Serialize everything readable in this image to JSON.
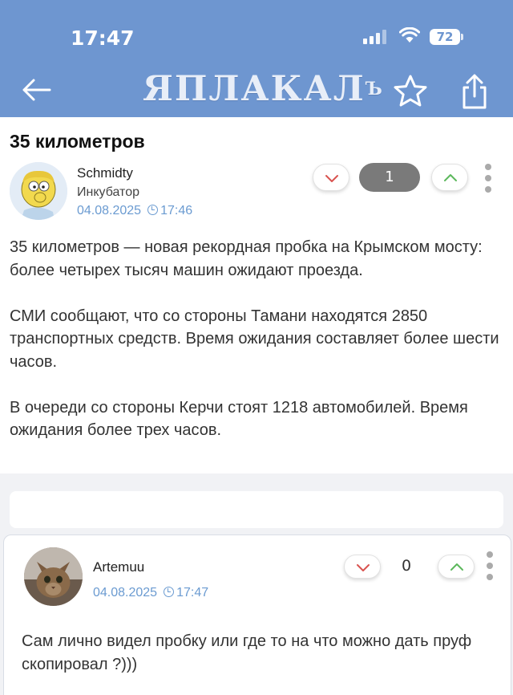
{
  "status_bar": {
    "time": "17:47",
    "battery": "72",
    "icons": [
      "signal-icon",
      "wifi-icon",
      "battery-icon"
    ]
  },
  "nav": {
    "logo_text": "ЯПЛАКАЛ",
    "logo_sup": "Ъ",
    "icons": [
      "back-arrow-icon",
      "star-icon",
      "share-icon"
    ]
  },
  "post": {
    "title": "35 километров",
    "author": "Schmidty",
    "author_status": "Инкубатор",
    "date": "04.08.2025",
    "time": "17:46",
    "rating": "1",
    "paragraphs": [
      "35 километров — новая рекордная пробка на Крымском мосту: более четырех тысяч машин ожидают проезда.",
      "СМИ сообщают, что со стороны Тамани находятся 2850 транспортных средств. Время ожидания составляет более шести часов.",
      "В очереди со стороны Керчи стоят 1218 автомобилей. Время ожидания более трех часов."
    ]
  },
  "comment": {
    "author": "Artemuu",
    "date": "04.08.2025",
    "time": "17:47",
    "rating": "0",
    "text": "Сам лично видел пробку или где то на что можно дать пруф скопировал ?)))"
  },
  "colors": {
    "header_bg": "#6e96d0",
    "date_blue": "#6b9bd1",
    "downvote": "#d9534f",
    "upvote": "#5cb85c",
    "rating_pill": "#7a7a7a"
  }
}
